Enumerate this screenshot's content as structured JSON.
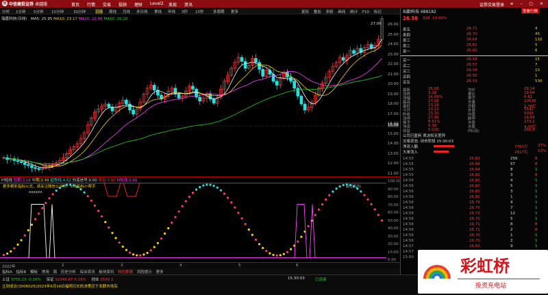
{
  "app": {
    "brand": "中信建投证券",
    "edition": "卓越版",
    "menus": [
      "首页",
      "行情",
      "交易",
      "投顾",
      "理财",
      "Level2",
      "发现",
      "资讯"
    ],
    "title_right": "证券交易登录"
  },
  "periods": {
    "items": [
      "分时",
      "1分钟",
      "5分钟",
      "15分钟",
      "30分钟",
      "日线",
      "周线",
      "月线",
      "多日线",
      "季线",
      "年线",
      "3秒",
      "15秒",
      "多周期",
      "更多"
    ],
    "active": "日线"
  },
  "toolbar": {
    "items": [
      "复权",
      "叠加",
      "多股",
      "画线",
      "统计",
      "F10",
      "标记"
    ]
  },
  "chart": {
    "stock_label": "瑞嘉科技(日线)",
    "ma_label": "均线",
    "ma5": "MA5: 25.95",
    "ma10": "MA10: 23.17",
    "ma20": "MA20: 22.40",
    "ma60": "MA60: 20.18",
    "high_label": "27.08",
    "low_label": "11.29",
    "price_ticks": [
      "26.00",
      "25.00",
      "24.00",
      "23.00",
      "22.00",
      "21.00",
      "20.00",
      "19.00",
      "18.00",
      "17.00",
      "16.00",
      "15.58",
      "15.00",
      "14.00",
      "13.00",
      "12.00",
      "11.00"
    ]
  },
  "indicator": {
    "name": "PI短线",
    "line1": "短期:3.14",
    "line2": "中期:3.49",
    "line3": "趋势线:4.52",
    "line4": "抄底信号:0.00",
    "line5": "卖出:0.00",
    "line6": "PI短线:0.66",
    "note1": "更多精彩指标公式，请关注微信公众号：K线指标小帮手",
    "note2": "xxxxxx",
    "ticks": [
      "100.00",
      "90.00",
      "80.00",
      "70.00",
      "60.00",
      "50.00",
      "40.00",
      "30.00",
      "20.00",
      "10.00",
      "0.00"
    ],
    "extra_label": "副图指标"
  },
  "xaxis": {
    "labels": [
      "2022年",
      "2",
      "3",
      "4",
      "5",
      "6"
    ]
  },
  "tabs": {
    "items": [
      "指标A",
      "指标B",
      "模板",
      "常用",
      "周",
      "历史分析",
      "综合资讯",
      "板块资讯",
      "特色数据",
      "风险提示",
      "更多"
    ]
  },
  "quote": {
    "code": "688182",
    "name": "灿勤科技",
    "tag": "查看行情",
    "price": "26.58",
    "change": "328",
    "pct": "14.09%",
    "asks": [
      {
        "l": "卖五",
        "p": "26.71",
        "v": "4"
      },
      {
        "l": "卖四",
        "p": "26.70",
        "v": "45"
      },
      {
        "l": "卖三",
        "p": "26.64",
        "v": "110"
      },
      {
        "l": "卖二",
        "p": "26.61",
        "v": "5"
      },
      {
        "l": "卖一",
        "p": "26.60",
        "v": "6"
      }
    ],
    "bids": [
      {
        "l": "买一",
        "p": "26.58",
        "v": "15"
      },
      {
        "l": "买二",
        "p": "26.57",
        "v": "7"
      },
      {
        "l": "买三",
        "p": "26.56",
        "v": "13"
      },
      {
        "l": "买四",
        "p": "26.55",
        "v": "1"
      },
      {
        "l": "买五",
        "p": "26.53",
        "v": "530"
      }
    ],
    "stats": [
      [
        "最新",
        "26.58",
        "均价",
        "26.14"
      ],
      [
        "涨跌",
        "3.28",
        "量比",
        "18.64"
      ],
      [
        "涨幅",
        "14.09%",
        "换手",
        "6.81"
      ],
      [
        "最高",
        "27.08",
        "总量",
        "10636"
      ],
      [
        "最低",
        "23.18",
        "总额",
        "2.78亿"
      ],
      [
        "今开",
        "23.10",
        "外盘",
        "5541"
      ],
      [
        "昨收",
        "23.30",
        "内盘",
        "5095"
      ],
      [
        "涨停",
        "27.96",
        "跌停",
        "18.64"
      ],
      [
        "换手",
        "8.61%",
        "市盈",
        "273.2"
      ],
      [
        "净资",
        "5.30",
        "总股",
        "4.00亿"
      ],
      [
        "收益",
        "0.030",
        "PE(动)",
        "260.9"
      ]
    ],
    "company": "公司已盈利 表决权无差异",
    "status_line": "交易状态: 闭市阶段 15:30:03",
    "flow": [
      {
        "l": "净流入额",
        "v": "7763万",
        "p": "37%"
      },
      {
        "l": "大单流入",
        "v": "2817万",
        "p": "13%"
      }
    ]
  },
  "ticks": [
    {
      "t": "14:55",
      "p": "26.83",
      "v": "256",
      "f": "B"
    },
    {
      "t": "14:55",
      "p": "26.84",
      "v": "57",
      "f": "B"
    },
    {
      "t": "14:55",
      "p": "26.84",
      "v": "8",
      "f": "S"
    },
    {
      "t": "14:55",
      "p": "26.82",
      "v": "3",
      "f": "B"
    },
    {
      "t": "14:56",
      "p": "26.80",
      "v": "4",
      "f": "S"
    },
    {
      "t": "14:56",
      "p": "26.80",
      "v": "5",
      "f": "S"
    },
    {
      "t": "14:56",
      "p": "26.80",
      "v": "3",
      "f": "S"
    },
    {
      "t": "14:56",
      "p": "26.80",
      "v": "1",
      "f": "S"
    },
    {
      "t": "14:56",
      "p": "26.79",
      "v": "4",
      "f": "S"
    },
    {
      "t": "14:56",
      "p": "26.75",
      "v": "7",
      "f": "S"
    },
    {
      "t": "14:56",
      "p": "26.73",
      "v": "12",
      "f": "S"
    },
    {
      "t": "14:56",
      "p": "26.70",
      "v": "5",
      "f": "S"
    },
    {
      "t": "14:56",
      "p": "26.71",
      "v": "8",
      "f": "B"
    },
    {
      "t": "14:56",
      "p": "26.71",
      "v": "2",
      "f": "B"
    },
    {
      "t": "14:56",
      "p": "26.70",
      "v": "1",
      "f": "S"
    },
    {
      "t": "14:56",
      "p": "26.70",
      "v": "2",
      "f": "S"
    },
    {
      "t": "14:57",
      "p": "26.60",
      "v": "9",
      "f": "S"
    },
    {
      "t": "14:57",
      "p": "26.66",
      "v": "3",
      "f": "B"
    },
    {
      "t": "15:00",
      "p": "26.58",
      "v": "1023",
      "f": "S"
    }
  ],
  "status": {
    "index1": "上证",
    "v1": "3755.23",
    "c1": "-0.26%",
    "index2": "深证",
    "v2": "12345.67",
    "c2": "0.19%",
    "index3": "创业",
    "v3": "2530.2",
    "news": "立刻成交(3006025)2023年6月16日福明兄长的决策应于发酵市场后",
    "time": "15:30:03",
    "connect": "已连接"
  },
  "watermark": {
    "title": "彩虹桥",
    "subtitle": "投资充电站"
  }
}
